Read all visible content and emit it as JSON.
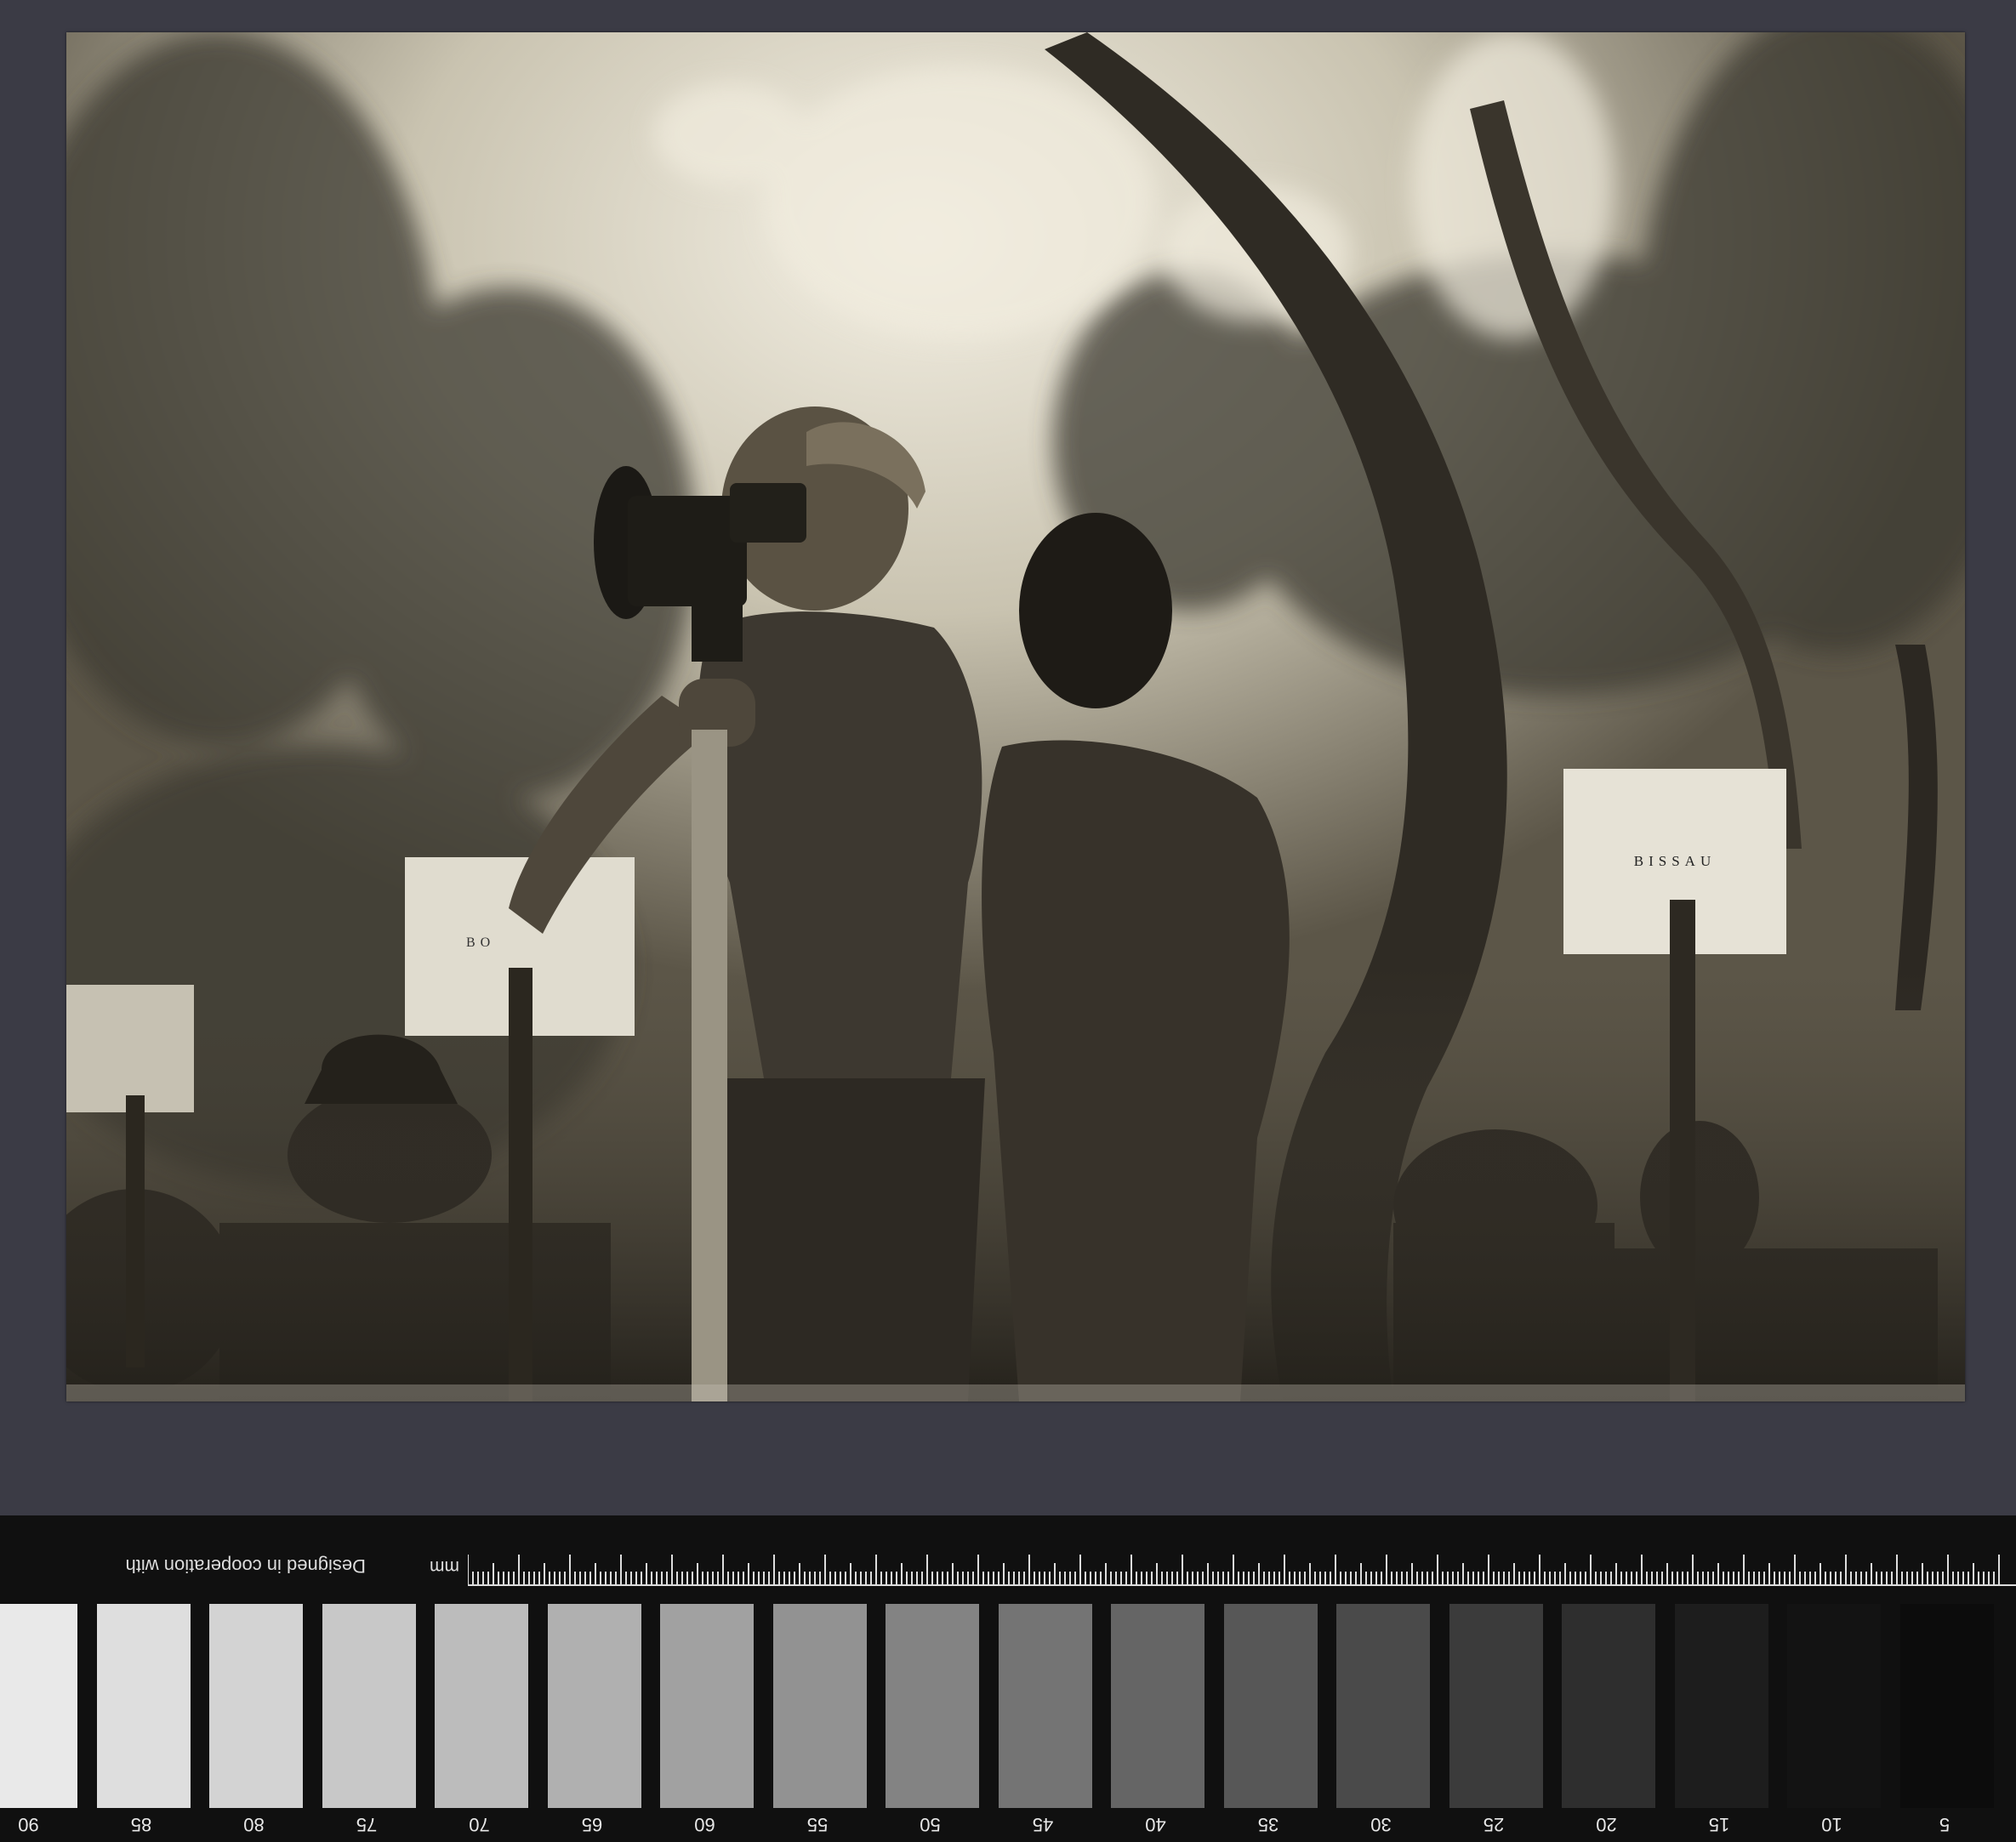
{
  "photo": {
    "signs": {
      "left_partial": "BO",
      "right": "BISSAU"
    }
  },
  "scale_strip": {
    "unit_label": "mm",
    "credit_text": "Designed in cooperation with",
    "patch_numbers": [
      "5",
      "10",
      "15",
      "20",
      "25",
      "30",
      "35",
      "40",
      "45",
      "50",
      "55",
      "60",
      "65",
      "70",
      "75",
      "80",
      "85",
      "90"
    ],
    "patch_colors": [
      "#0c0c0c",
      "#131313",
      "#1d1d1d",
      "#2e2e2e",
      "#3b3b3b",
      "#4a4a4a",
      "#575757",
      "#656565",
      "#747474",
      "#838383",
      "#929292",
      "#a1a1a1",
      "#b0b0b0",
      "#bcbcbc",
      "#c8c8c8",
      "#d3d3d3",
      "#dedede",
      "#e9e9e9"
    ]
  }
}
